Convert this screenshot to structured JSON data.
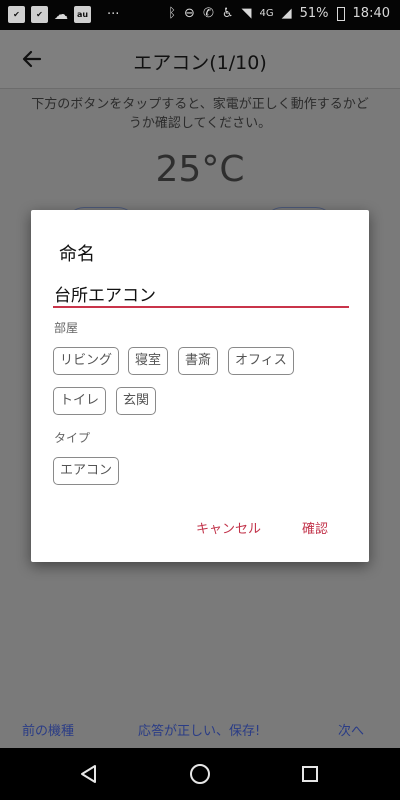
{
  "status_bar": {
    "battery": "51%",
    "time": "18:40",
    "network_label": "4G"
  },
  "app_bar": {
    "title": "エアコン(1/10)"
  },
  "main": {
    "instruction": "下方のボタンをタップすると、家電が正しく動作するかどうか確認してください。",
    "temperature": "25°C"
  },
  "bottom_links": {
    "prev": "前の機種",
    "save": "応答が正しい、保存!",
    "next": "次へ"
  },
  "dialog": {
    "title": "命名",
    "name_value": "台所エアコン",
    "room_label": "部屋",
    "rooms": [
      "リビング",
      "寝室",
      "書斎",
      "オフィス",
      "トイレ",
      "玄関"
    ],
    "type_label": "タイプ",
    "types": [
      "エアコン"
    ],
    "cancel_label": "キャンセル",
    "confirm_label": "確認"
  },
  "colors": {
    "accent": "#c2334a",
    "link": "#2a3c86"
  }
}
